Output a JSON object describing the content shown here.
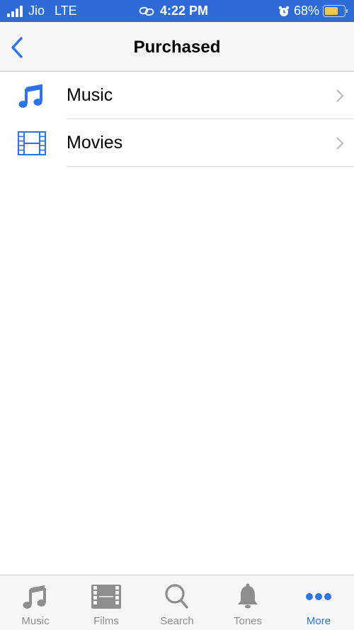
{
  "status_bar": {
    "carrier": "Jio",
    "network": "LTE",
    "time": "4:22 PM",
    "battery_percent_text": "68%",
    "battery_level": 0.68,
    "icons": [
      "signal-icon",
      "link-icon",
      "alarm-icon",
      "battery-icon"
    ]
  },
  "nav": {
    "title": "Purchased",
    "back_icon": "chevron-left-icon"
  },
  "list": {
    "items": [
      {
        "label": "Music",
        "icon": "music-note-icon"
      },
      {
        "label": "Movies",
        "icon": "film-icon"
      }
    ]
  },
  "tab_bar": {
    "tabs": [
      {
        "label": "Music",
        "icon": "music-note-icon",
        "active": false
      },
      {
        "label": "Films",
        "icon": "film-icon",
        "active": false
      },
      {
        "label": "Search",
        "icon": "search-icon",
        "active": false
      },
      {
        "label": "Tones",
        "icon": "bell-icon",
        "active": false
      },
      {
        "label": "More",
        "icon": "more-icon",
        "active": true
      }
    ]
  },
  "colors": {
    "accent": "#2f74e6",
    "status_bar_bg": "#2e6bd6",
    "battery_fill": "#f7c948",
    "inactive_tab": "#8e8e8e"
  }
}
